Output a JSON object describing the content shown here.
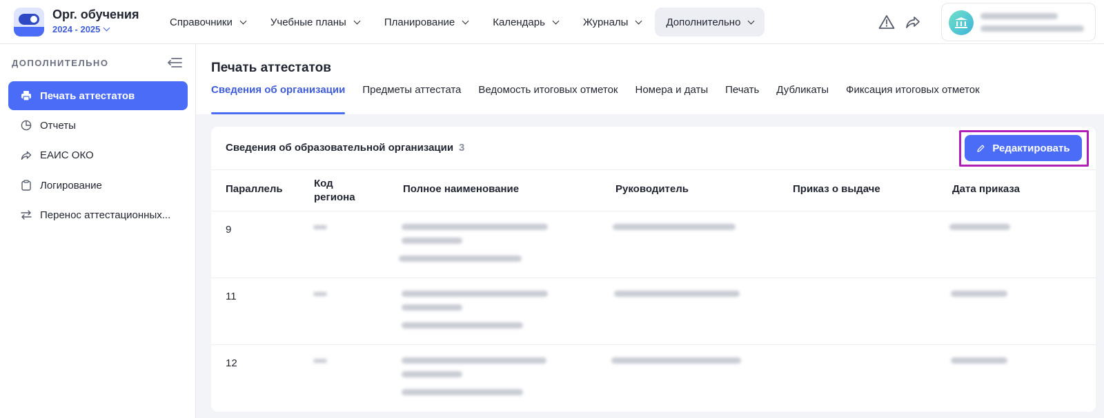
{
  "app": {
    "title": "Орг. обучения",
    "year": "2024 - 2025"
  },
  "nav": [
    {
      "label": "Справочники"
    },
    {
      "label": "Учебные планы"
    },
    {
      "label": "Планирование"
    },
    {
      "label": "Календарь"
    },
    {
      "label": "Журналы"
    },
    {
      "label": "Дополнительно"
    }
  ],
  "header_icons": [
    "warning-icon",
    "share-icon"
  ],
  "sidebar": {
    "title": "ДОПОЛНИТЕЛЬНО",
    "items": [
      {
        "label": "Печать аттестатов",
        "icon": "printer-icon"
      },
      {
        "label": "Отчеты",
        "icon": "pie-chart-icon"
      },
      {
        "label": "ЕАИС ОКО",
        "icon": "share-icon"
      },
      {
        "label": "Логирование",
        "icon": "clipboard-icon"
      },
      {
        "label": "Перенос аттестационных..."
      }
    ]
  },
  "main": {
    "title": "Печать аттестатов",
    "tabs": [
      {
        "label": "Сведения об организации"
      },
      {
        "label": "Предметы аттестата"
      },
      {
        "label": "Ведомость итоговых отметок"
      },
      {
        "label": "Номера и даты"
      },
      {
        "label": "Печать"
      },
      {
        "label": "Дубликаты"
      },
      {
        "label": "Фиксация итоговых отметок"
      }
    ]
  },
  "card": {
    "title": "Сведения об образовательной организации",
    "count": "3",
    "edit_label": "Редактировать",
    "columns": [
      "Параллель",
      "Код\nрегиона",
      "Полное наименование",
      "Руководитель",
      "Приказ о выдаче",
      "Дата приказа"
    ],
    "rows": [
      {
        "parallel": "9"
      },
      {
        "parallel": "11"
      },
      {
        "parallel": "12"
      }
    ]
  },
  "colors": {
    "accent": "#4a6cf7",
    "highlight": "#b020b8"
  }
}
